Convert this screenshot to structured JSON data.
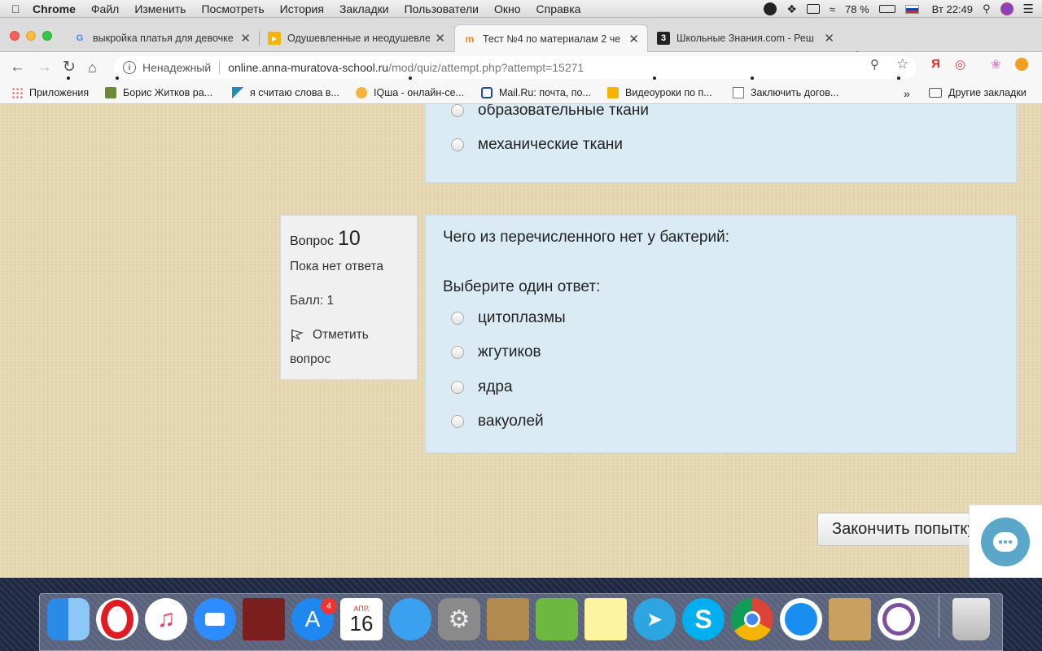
{
  "menubar": {
    "app": "Chrome",
    "items": [
      "Файл",
      "Изменить",
      "Посмотреть",
      "История",
      "Закладки",
      "Пользователи",
      "Окно",
      "Справка"
    ],
    "battery": "78 %",
    "clock": "Вт 22:49"
  },
  "tabs": [
    {
      "title": "выкройка платья для девочке",
      "favicon": "google-icon"
    },
    {
      "title": "Одушевленные и неодушевле",
      "favicon": "slides-icon"
    },
    {
      "title": "Тест №4 по материалам 2 че",
      "favicon": "moodle-icon",
      "active": true
    },
    {
      "title": "Школьные Знания.com - Реш",
      "favicon": "znanija-icon"
    }
  ],
  "omnibox": {
    "security": "Ненадежный",
    "url_host": "online.anna-muratova-school.ru",
    "url_path": "/mod/quiz/attempt.php?attempt=15271"
  },
  "bookmarks": {
    "items": [
      "Приложения",
      "Борис Житков ра...",
      "я считаю слова в...",
      "IQша - онлайн-се...",
      "Mail.Ru: почта, по...",
      "Видеоуроки по п...",
      "Заключить догов..."
    ],
    "more": "»",
    "other": "Другие закладки"
  },
  "prev_question": {
    "options": [
      "образовательные ткани",
      "механические ткани"
    ]
  },
  "question": {
    "label": "Вопрос",
    "number": "10",
    "state": "Пока нет ответа",
    "mark": "Балл: 1",
    "flag_line1": "Отметить",
    "flag_line2": "вопрос",
    "text": "Чего из перечисленного нет у бактерий:",
    "prompt": "Выберите один ответ:",
    "options": [
      "цитоплазмы",
      "жгутиков",
      "ядра",
      "вакуолей"
    ]
  },
  "finish_button": "Закончить попытку",
  "dock": {
    "calendar_month": "АПР.",
    "calendar_day": "16",
    "appstore_badge": "4"
  }
}
